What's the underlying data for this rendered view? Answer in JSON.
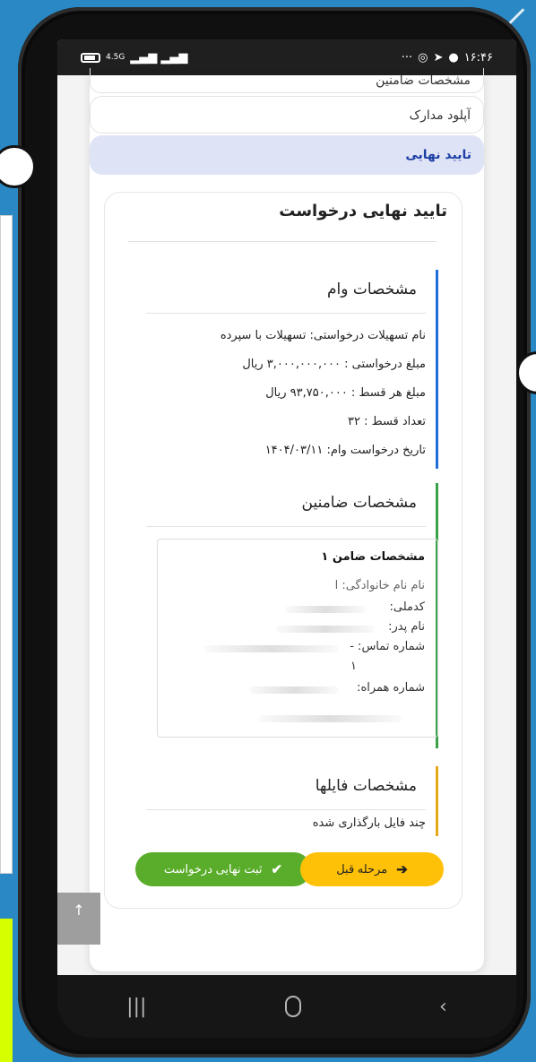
{
  "statusbar": {
    "network": "4.5G",
    "time": "۱۶:۴۶",
    "more": "···"
  },
  "steps": {
    "cut_label": "مشخصات ضامنین",
    "upload_label": "آپلود مدارک",
    "active_label": "تایید نهایی"
  },
  "card": {
    "title": "تایید نهایی درخواست",
    "loan": {
      "title": "مشخصات وام",
      "accent": "#1e6fd9",
      "lines": [
        "نام تسهیلات درخواستی: تسهیلات با سپرده",
        "مبلغ درخواستی : ۳,۰۰۰,۰۰۰,۰۰۰ ریال",
        "مبلغ هر قسط : ۹۳,۷۵۰,۰۰۰ ریال",
        "تعداد قسط : ۳۲",
        "تاریخ درخواست وام: ۱۴۰۴/۰۳/۱۱"
      ]
    },
    "guarantors": {
      "title": "مشخصات ضامنین",
      "accent": "#3aa34a",
      "g1_title": "مشخصات ضامن ۱",
      "g1_name": "نام نام خانوادگی: ا",
      "g1_national": "کدملی:",
      "g1_father": "نام پدر:",
      "g1_phone": "شماره تماس: -",
      "g1_phone_extra": "۱",
      "g1_mobile": "شماره همراه:"
    },
    "files": {
      "title": "مشخصات فایلها",
      "accent": "#e5a81a",
      "text": "چند فایل بارگذاری شده"
    },
    "buttons": {
      "prev_label": "مرحله قبل",
      "submit_label": "ثبت نهایی درخواست",
      "prev_color": "#ffc107",
      "submit_color": "#5aad2b"
    }
  },
  "scroll_top_icon": "↑",
  "navbar": {
    "recents_icon": "|||",
    "back_icon": "‹"
  }
}
